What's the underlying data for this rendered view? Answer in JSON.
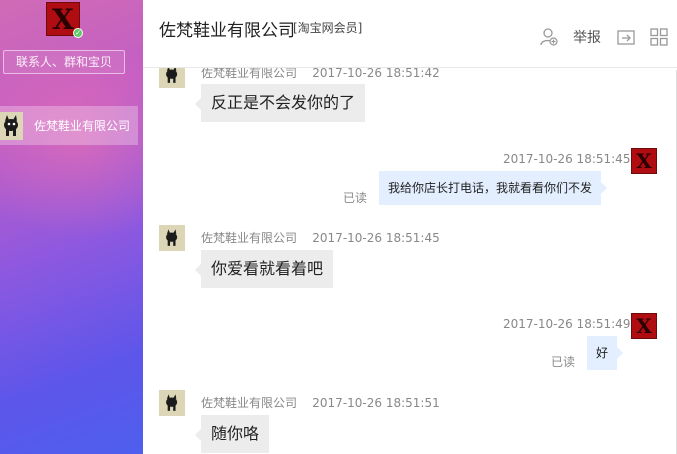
{
  "sidebar": {
    "search_placeholder": "联系人、群和宝贝",
    "avatar_letter": "X",
    "conversations": [
      {
        "name": "佐梵鞋业有限公司"
      }
    ]
  },
  "header": {
    "title": "佐梵鞋业有限公司",
    "badge": "[淘宝网会员]",
    "report_label": "举报",
    "icons": [
      "add-contact-icon",
      "share-icon",
      "grid-icon"
    ]
  },
  "messages": [
    {
      "sender": "佐梵鞋业有限公司",
      "time": "2017-10-26 18:51:42",
      "text": "反正是不会发你的了",
      "direction": "in"
    },
    {
      "time": "2017-10-26 18:51:45",
      "text": "我给你店长打电话，我就看看你们不发",
      "direction": "out",
      "status": "已读"
    },
    {
      "sender": "佐梵鞋业有限公司",
      "time": "2017-10-26 18:51:45",
      "text": "你爱看就看着吧",
      "direction": "in"
    },
    {
      "time": "2017-10-26 18:51:49",
      "text": "好",
      "direction": "out",
      "status": "已读"
    },
    {
      "sender": "佐梵鞋业有限公司",
      "time": "2017-10-26 18:51:51",
      "text": "随你咯",
      "direction": "in"
    }
  ],
  "colors": {
    "sidebar_top": "#d06bb6",
    "sidebar_bottom": "#4e5fee",
    "incoming_bubble": "#ececec",
    "outgoing_bubble": "#e3efff",
    "online": "#62c96a"
  }
}
